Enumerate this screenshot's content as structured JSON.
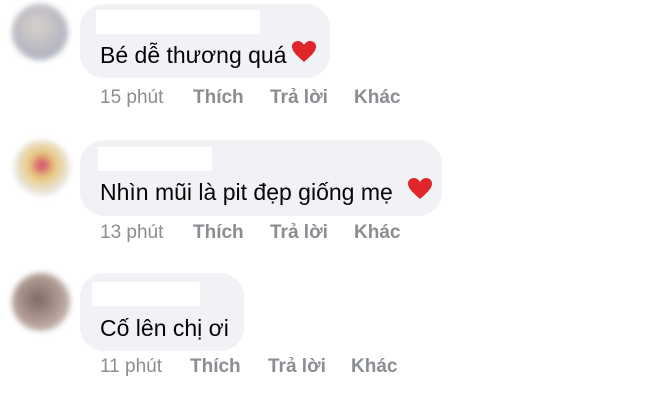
{
  "colors": {
    "bubble": "#f0f2f5",
    "text": "#050505",
    "meta": "#8a8d91",
    "heart": "#e0262a"
  },
  "comments": [
    {
      "text": "Bé dễ thương quá",
      "icon": "red-heart-icon",
      "time": "15 phút",
      "like": "Thích",
      "reply": "Trả lời",
      "more": "Khác"
    },
    {
      "text": "Nhìn mũi là pit đẹp giống mẹ",
      "icon": "red-heart-icon",
      "time": "13 phút",
      "like": "Thích",
      "reply": "Trả lời",
      "more": "Khác"
    },
    {
      "text": "Cố lên chị ơi",
      "time": "11 phút",
      "like": "Thích",
      "reply": "Trả lời",
      "more": "Khác"
    }
  ]
}
